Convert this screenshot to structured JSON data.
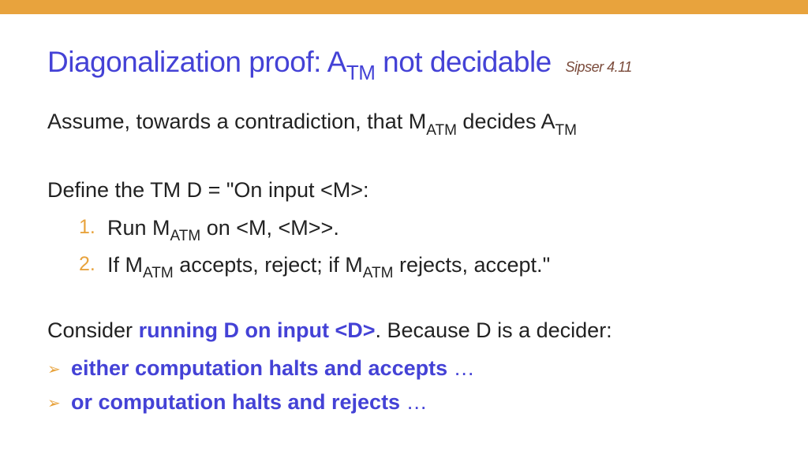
{
  "title": {
    "part1": "Diagonalization proof: A",
    "sub1": "TM",
    "part2": " not decidable",
    "reference": "Sipser 4.11"
  },
  "line1": {
    "t1": "Assume, towards a contradiction, that M",
    "s1": "ATM",
    "t2": " decides A",
    "s2": "TM"
  },
  "line2": "Define the TM D = \"On input <M>:",
  "step1": {
    "num": "1.",
    "t1": "Run M",
    "s1": "ATM",
    "t2": " on <M, <M>>."
  },
  "step2": {
    "num": "2.",
    "t1": "If M",
    "s1": "ATM",
    "t2": " accepts, reject; if M",
    "s2": "ATM",
    "t3": " rejects, accept.\""
  },
  "line3": {
    "t1": "Consider ",
    "bold": "running D on input <D>",
    "t2": ". Because D is a decider:"
  },
  "bullet1": {
    "text": "either computation halts and accepts",
    "ell": " …"
  },
  "bullet2": {
    "text": "or computation halts and rejects",
    "ell": "  …"
  }
}
